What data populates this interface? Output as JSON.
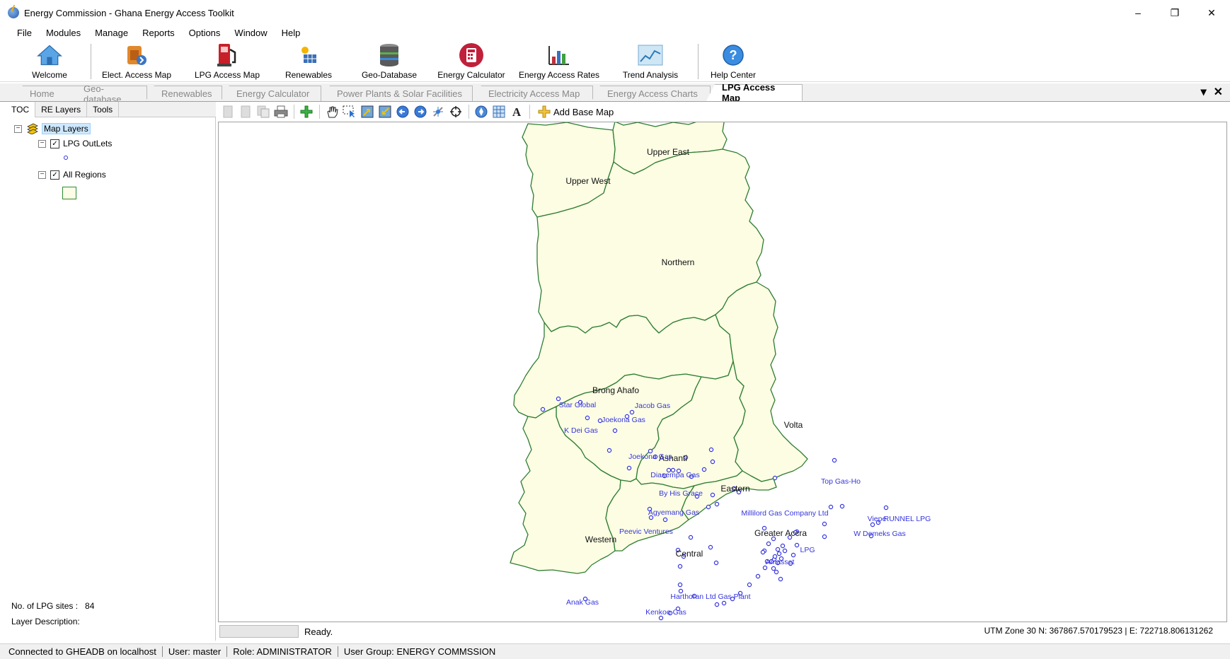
{
  "window": {
    "title": "Energy Commission - Ghana Energy Access Toolkit",
    "controls": [
      "–",
      "❐",
      "✕"
    ]
  },
  "menu": [
    "File",
    "Modules",
    "Manage",
    "Reports",
    "Options",
    "Window",
    "Help"
  ],
  "ribbon": [
    {
      "label": "Welcome",
      "icon": "home-icon"
    },
    {
      "label": "Elect. Access Map",
      "icon": "electricity-map-icon"
    },
    {
      "label": "LPG Access Map",
      "icon": "lpg-pump-icon"
    },
    {
      "label": "Renewables",
      "icon": "solar-panel-icon"
    },
    {
      "label": "Geo-Database",
      "icon": "database-icon"
    },
    {
      "label": "Energy Calculator",
      "icon": "calculator-icon"
    },
    {
      "label": "Energy Access Rates",
      "icon": "bar-chart-icon"
    },
    {
      "label": "Trend Analysis",
      "icon": "trend-chart-icon"
    },
    {
      "label": "Help Center",
      "icon": "help-icon"
    }
  ],
  "tabs": [
    {
      "label": "Home",
      "active": false
    },
    {
      "label": "Geo-database",
      "active": false
    },
    {
      "label": "Renewables",
      "active": false
    },
    {
      "label": "Energy Calculator",
      "active": false
    },
    {
      "label": "Power Plants & Solar Facilities",
      "active": false
    },
    {
      "label": "Electricity Access Map",
      "active": false
    },
    {
      "label": "Energy Access Charts",
      "active": false
    },
    {
      "label": "LPG Access Map",
      "active": true
    }
  ],
  "tab_controls": [
    "▾",
    "✕"
  ],
  "left_panel": {
    "tabs": [
      "TOC",
      "RE Layers",
      "Tools"
    ],
    "root": "Map Layers",
    "layers": [
      {
        "name": "LPG OutLets",
        "checked": true
      },
      {
        "name": "All Regions",
        "checked": true
      }
    ],
    "sites_label": "No. of  LPG sites :",
    "sites_count": "84",
    "layer_desc_label": "Layer Description:"
  },
  "map_toolbar": {
    "add_base_map": "Add Base Map"
  },
  "map": {
    "regions": [
      {
        "name": "Upper East"
      },
      {
        "name": "Upper West"
      },
      {
        "name": "Northern"
      },
      {
        "name": "Brong Ahafo"
      },
      {
        "name": "Volta"
      },
      {
        "name": "Ashanti"
      },
      {
        "name": "Eastern"
      },
      {
        "name": "Greater Accra"
      },
      {
        "name": "Western"
      },
      {
        "name": "Central"
      }
    ],
    "outlets": [
      "Star Global",
      "Jacob Gas",
      "Joekona Gas",
      "K Dei Gas",
      "Joekona Gas",
      "Diasempa Gas",
      "By His Grace",
      "Top Gas-Ho",
      "Agyemang Gas",
      "Millilord Gas Company Ltd",
      "Viepe",
      "RUNNEL LPG",
      "W Demeks Gas",
      "Peevic Ventures",
      "LPG",
      "Amasset",
      "Harthoran Ltd Gas Plant",
      "Anak Gas",
      "Kenkoo Gas"
    ],
    "colors": {
      "fill": "#fcfde3",
      "border": "#2e7d32",
      "outlet": "#3535e0"
    }
  },
  "map_status": {
    "status": "Ready.",
    "coordinates": "UTM Zone 30  N: 367867.570179523  |  E: 722718.806131262"
  },
  "statusbar": [
    "Connected to GHEADB on localhost",
    "User: master",
    "Role: ADMINISTRATOR",
    "User Group: ENERGY COMMSSION"
  ]
}
